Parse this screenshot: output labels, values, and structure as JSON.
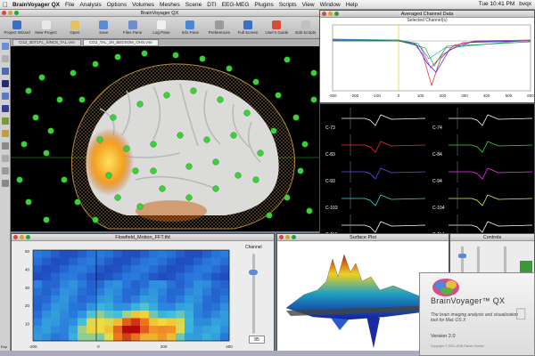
{
  "menubar": {
    "app_name": "BrainVoyager QX",
    "items": [
      "File",
      "Analysis",
      "Options",
      "Volumes",
      "Meshes",
      "Scene",
      "DTI",
      "EEG-MEG",
      "Plugins",
      "Scripts",
      "View",
      "Window",
      "Help"
    ],
    "clock": "Tue 10:41 PM",
    "user": "bvqx"
  },
  "main_window": {
    "title": "BrainVoyager QX",
    "toolbar": [
      {
        "label": "Project Wizard",
        "color": "#3a6fc4"
      },
      {
        "label": "New Project",
        "color": "#e8e8e8"
      },
      {
        "label": "Open",
        "color": "#e3c35a"
      },
      {
        "label": "Save",
        "color": "#5b8ad6"
      },
      {
        "label": "Files Pane",
        "color": "#6b8fcf"
      },
      {
        "label": "Log Pane",
        "color": "#f0f0f0"
      },
      {
        "label": "Info Pane",
        "color": "#4a86d8"
      },
      {
        "label": "Preferences",
        "color": "#9a9a9a"
      },
      {
        "label": "Full Screen",
        "color": "#3a6fc4"
      },
      {
        "label": "User's Guide",
        "color": "#d84a3a"
      },
      {
        "label": "Edit Scripts",
        "color": "#c0c0c0"
      }
    ],
    "tabs": [
      "CG2_3DT1FL_SINC8_TAL.vmr",
      "CG2_TAL_3H_BEDSOM_OHS.vmr"
    ],
    "colors": {
      "scalp_mesh": "#b58a3a",
      "electrode": "#3ad13a",
      "cortex": "#f2f2f2",
      "activation": "#f2a020"
    }
  },
  "averaged_window": {
    "title": "Averaged Channel Data",
    "subtitle": "Selected Channel(s)",
    "x_ticks": [
      "-300",
      "-200",
      "-100",
      "0",
      "100",
      "200",
      "300",
      "400",
      "500",
      "600"
    ]
  },
  "channels_window": {
    "channels": [
      {
        "label": "C-73",
        "color": "#ffffff"
      },
      {
        "label": "C-74",
        "color": "#ffffff"
      },
      {
        "label": "C-83",
        "color": "#ff2a2a"
      },
      {
        "label": "C-84",
        "color": "#33dd33"
      },
      {
        "label": "C-93",
        "color": "#5555ff"
      },
      {
        "label": "C-94",
        "color": "#ff33ff"
      },
      {
        "label": "C-103",
        "color": "#33dddd"
      },
      {
        "label": "C-104",
        "color": "#eeee55"
      },
      {
        "label": "C-113",
        "color": "#ffffff"
      },
      {
        "label": "C-114",
        "color": "#ffffff"
      }
    ]
  },
  "tf_window": {
    "title": "Flowfield_Motion_FFT.tfd",
    "channel_label": "Channel",
    "channel_value": "85",
    "y_ticks": [
      "50",
      "40",
      "30",
      "20",
      "10"
    ],
    "x_ticks": [
      "-200",
      "0",
      "200",
      "400"
    ]
  },
  "surface_window": {
    "title": "Surface Plot"
  },
  "controls_window": {
    "title": "Controls"
  },
  "about_box": {
    "name": "BrainVoyager™ QX",
    "tagline": "The brain imaging analysis and visualization tool for Mac OS X",
    "version": "Version 2.0",
    "copyright": "Copyright © 2001-2008 Rainer Goebel"
  },
  "sidebar_labels": [
    "Exp"
  ]
}
